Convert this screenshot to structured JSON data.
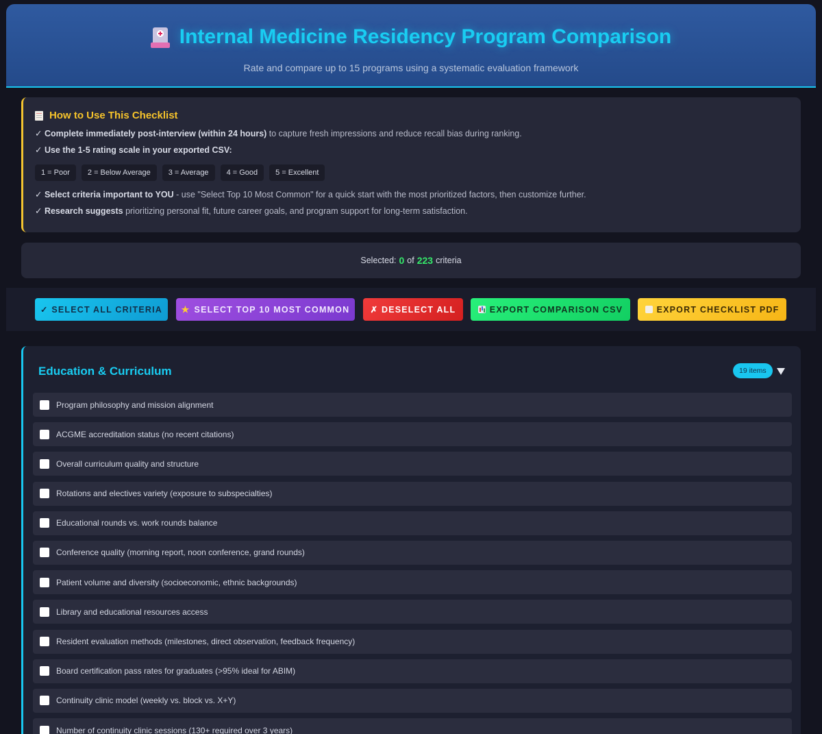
{
  "header": {
    "title": "Internal Medicine Residency Program Comparison",
    "subtitle": "Rate and compare up to 15 programs using a systematic evaluation framework",
    "icon": "hospital-icon"
  },
  "howto": {
    "title": "How to Use This Checklist",
    "line1_bold": "✓ Complete immediately post-interview (within 24 hours)",
    "line1_rest": " to capture fresh impressions and reduce recall bias during ranking.",
    "line2_bold": "✓ Use the 1-5 rating scale in your exported CSV:",
    "scale": [
      "1 = Poor",
      "2 = Below Average",
      "3 = Average",
      "4 = Good",
      "5 = Excellent"
    ],
    "line3_bold": "✓ Select criteria important to YOU",
    "line3_rest": " - use \"Select Top 10 Most Common\" for a quick start with the most prioritized factors, then customize further.",
    "line4_bold": "✓ Research suggests",
    "line4_rest": " prioritizing personal fit, future career goals, and program support for long-term satisfaction."
  },
  "counter": {
    "prefix": "Selected:",
    "selected": "0",
    "of": "of",
    "total": "223",
    "suffix": "criteria"
  },
  "toolbar": {
    "select_all": "✓ Select All Criteria",
    "select_top": "Select Top 10 Most Common",
    "deselect": "✗ Deselect All",
    "export_csv": "Export Comparison CSV",
    "export_pdf": "Export Checklist PDF"
  },
  "section": {
    "title": "Education & Curriculum",
    "count": "19 items",
    "items": [
      "Program philosophy and mission alignment",
      "ACGME accreditation status (no recent citations)",
      "Overall curriculum quality and structure",
      "Rotations and electives variety (exposure to subspecialties)",
      "Educational rounds vs. work rounds balance",
      "Conference quality (morning report, noon conference, grand rounds)",
      "Patient volume and diversity (socioeconomic, ethnic backgrounds)",
      "Library and educational resources access",
      "Resident evaluation methods (milestones, direct observation, feedback frequency)",
      "Board certification pass rates for graduates (>95% ideal for ABIM)",
      "Continuity clinic model (weekly vs. block vs. X+Y)",
      "Number of continuity clinic sessions (130+ required over 3 years)"
    ]
  },
  "colors": {
    "accent": "#19c6ef",
    "highlight": "#f4c430",
    "success": "#35e86a"
  }
}
